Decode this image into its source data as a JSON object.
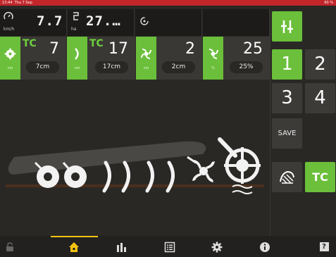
{
  "status": {
    "time": "13:44",
    "date": "Thu 7 Sep",
    "battery": "90 %"
  },
  "stats": [
    {
      "icon": "speed-gauge-icon",
      "unit": "km/h",
      "value": "7.7"
    },
    {
      "icon": "area-icon",
      "unit": "ha",
      "value": "27.…"
    },
    {
      "icon": "rotate-icon",
      "unit": "",
      "value": ""
    },
    {
      "icon": "",
      "unit": "",
      "value": ""
    }
  ],
  "settings": [
    {
      "icon": "packer-wheel-icon",
      "tc": "TC",
      "value": "7",
      "pill": "7cm",
      "unit": "cm"
    },
    {
      "icon": "disc-icon",
      "tc": "TC",
      "value": "17",
      "pill": "17cm",
      "unit": "cm"
    },
    {
      "icon": "tine-icon",
      "tc": "",
      "value": "2",
      "pill": "2cm",
      "unit": "cm"
    },
    {
      "icon": "seed-rate-icon",
      "tc": "",
      "value": "25",
      "pill": "25%",
      "unit": "%"
    }
  ],
  "panel": {
    "top_icon": "header-height-icon",
    "buttons": [
      "1",
      "2",
      "3",
      "4"
    ],
    "save": "SAVE",
    "tc": "TC",
    "field_icon": "field-icon"
  },
  "nav": [
    "lock-icon",
    "home-icon",
    "chart-icon",
    "list-icon",
    "gear-icon",
    "info-icon",
    "help-icon"
  ],
  "nav_help": "?",
  "colors": {
    "accent": "#6bbf3a",
    "status_bar": "#c2262b",
    "nav_active": "#f5c211"
  }
}
